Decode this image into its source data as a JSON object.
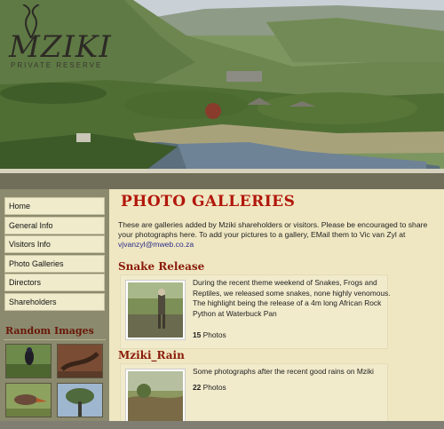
{
  "logo": {
    "name": "MZIKI",
    "subtitle": "PRIVATE RESERVE"
  },
  "nav": [
    {
      "label": "Home"
    },
    {
      "label": "General Info"
    },
    {
      "label": "Visitors Info"
    },
    {
      "label": "Photo Galleries"
    },
    {
      "label": "Directors"
    },
    {
      "label": "Shareholders"
    }
  ],
  "random_images": {
    "title": "Random Images"
  },
  "page": {
    "title": "PHOTO GALLERIES",
    "intro": "These are galleries added by Mziki shareholders or visitors. Please be encouraged to share your photographs here. To add your pictures to a gallery,  EMail them to Vic van Zyl at ",
    "email": "vjvanzyl@mweb.co.za"
  },
  "galleries": [
    {
      "title": "Snake Release",
      "description": "During the recent theme weekend of Snakes, Frogs and Reptiles, we released some snakes, none highly venomous. The highlight being the release of a 4m long African Rock Python at Waterbuck Pan",
      "count": "15",
      "count_label": "Photos"
    },
    {
      "title": "Mziki_Rain",
      "description": "Some photographs after the recent good rains on Mziki",
      "count": "22",
      "count_label": "Photos"
    }
  ],
  "colors": {
    "title_red": "#b2170c",
    "sidebar": "#8b8a6e",
    "page_bg": "#efe7c2"
  }
}
